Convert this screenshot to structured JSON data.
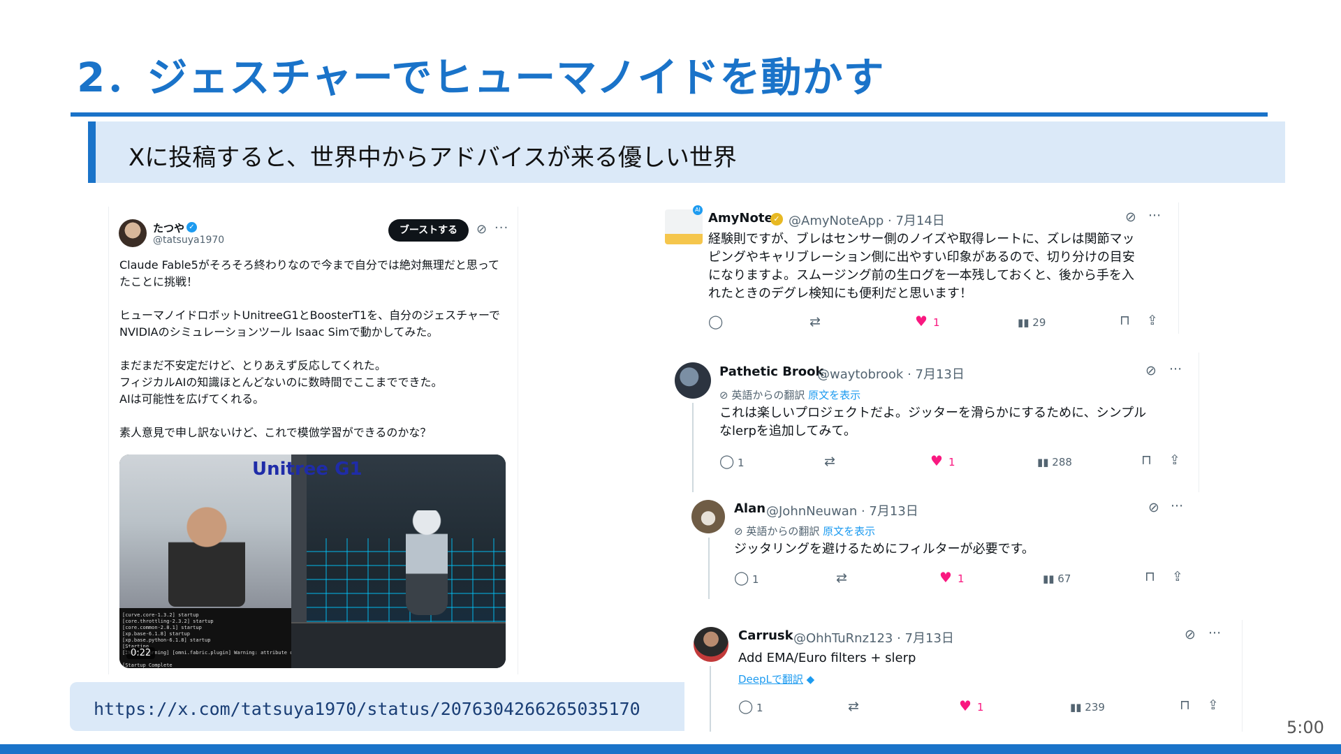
{
  "slide": {
    "title": "2．ジェスチャーでヒューマノイドを動かす",
    "subtitle": "Xに投稿すると、世界中からアドバイスが来る優しい世界",
    "url": "https://x.com/tatsuya1970/status/2076304266265035170",
    "timer": "5:00"
  },
  "post": {
    "name": "たつや",
    "handle": "@tatsuya1970",
    "boost_label": "ブーストする",
    "lines": [
      "Claude Fable5がそろそろ終わりなので今まで自分では絶対無理だと思って",
      "たことに挑戦！",
      "ヒューマノイドロボットUnitreeG1とBoosterT1を、自分のジェスチャーで",
      "NVIDIAのシミュレーションツール Isaac Simで動かしてみた。",
      "まだまだ不安定だけど、とりあえず反応してくれた。",
      "フィジカルAIの知識ほとんどないのに数時間でここまでできた。",
      "AIは可能性を広げてくれる。",
      "素人意見で申し訳ないけど、これで模倣学習ができるのかな？"
    ],
    "media": {
      "caption": "Unitree G1",
      "duration": "0:22",
      "terminal": "[curve.core-1.3.2] startup\n[core.throttling-2.3.2] startup\n[core.common-2.8.1] startup\n[xp.base-6.1.8] startup\n[xp.base.python-6.1.8] startup\n[Starting\n[INFO] [Warning] [omni.fabric.plugin] Warning: attribute overrideClip\n\n[Startup Complete"
    }
  },
  "replies": [
    {
      "name": "AmyNote",
      "handle": "@AmyNoteApp · 7月14日",
      "lines": [
        "経験則ですが、ブレはセンサー側のノイズや取得レートに、ズレは関節マッ",
        "ピングやキャリブレーション側に出やすい印象があるので、切り分けの目安",
        "になりますよ。スムージング前の生ログを一本残しておくと、後から手を入",
        "れたときのデグレ検知にも便利だと思います！"
      ],
      "replies": "",
      "likes": "1",
      "views": "29"
    },
    {
      "name": "Pathetic Brook",
      "handle": "@waytobrook · 7月13日",
      "translation": "英語からの翻訳",
      "show_original": "原文を表示",
      "lines": [
        "これは楽しいプロジェクトだよ。ジッターを滑らかにするために、シンプル",
        "なlerpを追加してみて。"
      ],
      "replies": "1",
      "likes": "1",
      "views": "288"
    },
    {
      "name": "Alan",
      "handle": "@JohnNeuwan · 7月13日",
      "translation": "英語からの翻訳",
      "show_original": "原文を表示",
      "lines": [
        "ジッタリングを避けるためにフィルターが必要です。"
      ],
      "replies": "1",
      "likes": "1",
      "views": "67"
    },
    {
      "name": "Carrusk",
      "handle": "@OhhTuRnz123 · 7月13日",
      "lines": [
        "Add EMA/Euro filters + slerp"
      ],
      "deepl": "DeepLで翻訳",
      "replies": "1",
      "likes": "1",
      "views": "239"
    }
  ],
  "colors": {
    "accent": "#1a73c9",
    "subtitle_bg": "#dbe9f8",
    "like": "#f91880",
    "link": "#1d9bf0"
  },
  "icons": [
    "reply-icon",
    "repost-icon",
    "like-icon",
    "views-icon",
    "bookmark-icon",
    "share-icon",
    "grok-icon",
    "more-icon",
    "verified-icon"
  ]
}
